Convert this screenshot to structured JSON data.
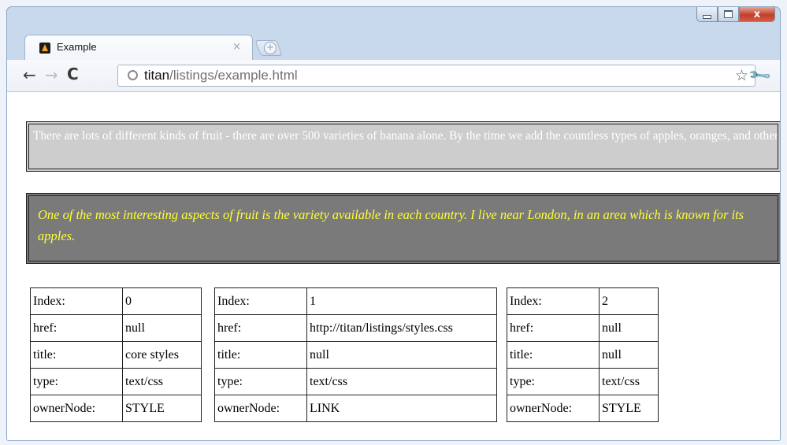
{
  "browser": {
    "tab_title": "Example",
    "tab_close": "×",
    "new_tab": "+",
    "url_host": "titan",
    "url_path": "/listings/example.html",
    "window_close": "x"
  },
  "content": {
    "paragraph1": "There are lots of different kinds of fruit - there are over 500 varieties of banana alone. By the time we add the countless types of apples, oranges, and other well-known fruit, we are faced with thousands of choices.",
    "paragraph2": "One of the most interesting aspects of fruit is the variety available in each country. I live near London, in an area which is known for its apples.",
    "tables": [
      {
        "rows": [
          {
            "label": "Index:",
            "value": "0"
          },
          {
            "label": "href:",
            "value": "null"
          },
          {
            "label": "title:",
            "value": "core styles"
          },
          {
            "label": "type:",
            "value": "text/css"
          },
          {
            "label": "ownerNode:",
            "value": "STYLE"
          }
        ]
      },
      {
        "rows": [
          {
            "label": "Index:",
            "value": "1"
          },
          {
            "label": "href:",
            "value": "http://titan/listings/styles.css"
          },
          {
            "label": "title:",
            "value": "null"
          },
          {
            "label": "type:",
            "value": "text/css"
          },
          {
            "label": "ownerNode:",
            "value": "LINK"
          }
        ]
      },
      {
        "rows": [
          {
            "label": "Index:",
            "value": "2"
          },
          {
            "label": "href:",
            "value": "null"
          },
          {
            "label": "title:",
            "value": "null"
          },
          {
            "label": "type:",
            "value": "text/css"
          },
          {
            "label": "ownerNode:",
            "value": "STYLE"
          }
        ]
      }
    ]
  },
  "colors": {
    "paragraph1_background": "#cdcdcd",
    "paragraph1_text": "#ffffff",
    "paragraph2_background": "#7a7a7a",
    "paragraph2_text": "#ffff33"
  }
}
